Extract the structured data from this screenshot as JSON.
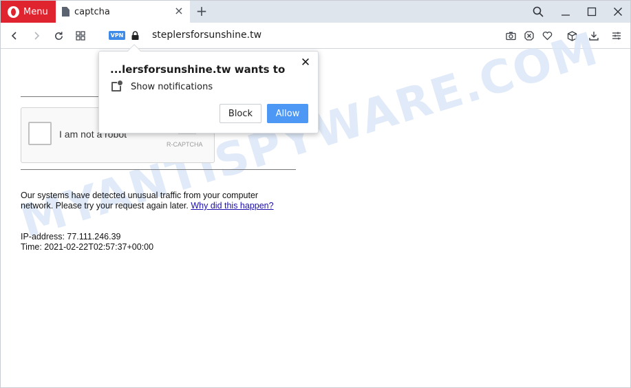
{
  "browser": {
    "menu_label": "Menu",
    "tab_title": "captcha",
    "vpn_label": "VPN",
    "url": "steplersforsunshine.tw"
  },
  "page": {
    "watermark": "MYANTISPYWARE.COM",
    "captcha": {
      "label": "I am not a robot",
      "brand": "R-CAPTCHA"
    },
    "message_line1": "Our systems have detected unusual traffic from your computer",
    "message_line2": "network. Please try your request again later.",
    "message_link": "Why did this happen?",
    "ip_line": "IP-address: 77.111.246.39",
    "time_line": "Time: 2021-02-22T02:57:37+00:00"
  },
  "popup": {
    "title": "...lersforsunshine.tw wants to",
    "permission": "Show notifications",
    "block_label": "Block",
    "allow_label": "Allow"
  },
  "colors": {
    "menu_red": "#e0242f",
    "allow_blue": "#4d98f5",
    "vpn_blue": "#3d8ae8",
    "watermark": "#dbe7f8"
  }
}
